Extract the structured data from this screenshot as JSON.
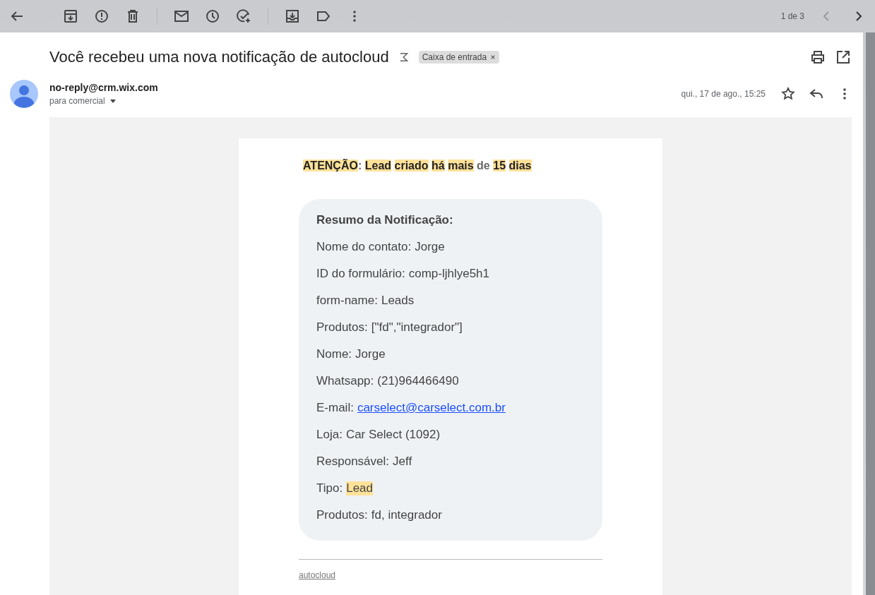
{
  "toolbar": {
    "pager": "1 de 3"
  },
  "email": {
    "subject": "Você recebeu uma nova notificação de autocloud",
    "label": "Caixa de entrada",
    "sender": "no-reply@crm.wix.com",
    "recipient": "para comercial",
    "date": "qui., 17 de ago., 15:25"
  },
  "alert": [
    {
      "text": "ATENÇÃO",
      "highlighted": true
    },
    {
      "text": ":",
      "highlighted": false,
      "attached": true
    },
    {
      "text": "Lead",
      "highlighted": true
    },
    {
      "text": "criado",
      "highlighted": true
    },
    {
      "text": "há",
      "highlighted": true
    },
    {
      "text": "mais",
      "highlighted": true
    },
    {
      "text": "de",
      "highlighted": false
    },
    {
      "text": "15",
      "highlighted": true
    },
    {
      "text": "dias",
      "highlighted": true
    }
  ],
  "summary": {
    "title": "Resumo da Notificação:",
    "fields": [
      {
        "label": "Nome do contato:",
        "value": "Jorge",
        "kind": "text"
      },
      {
        "label": "ID do formulário:",
        "value": "comp-ljhlye5h1",
        "kind": "text"
      },
      {
        "label": "form-name:",
        "value": "Leads",
        "kind": "text"
      },
      {
        "label": "Produtos:",
        "value": "[\"fd\",\"integrador\"]",
        "kind": "text"
      },
      {
        "label": "Nome:",
        "value": "Jorge",
        "kind": "text"
      },
      {
        "label": "Whatsapp:",
        "value": "(21)964466490",
        "kind": "text"
      },
      {
        "label": "E-mail:",
        "value": "carselect@carselect.com.br",
        "kind": "link"
      },
      {
        "label": "Loja:",
        "value": "Car Select (1092)",
        "kind": "text"
      },
      {
        "label": "Responsável:",
        "value": "Jeff",
        "kind": "text"
      },
      {
        "label": "Tipo:",
        "value": "Lead",
        "kind": "highlight"
      },
      {
        "label": "Produtos:",
        "value": "fd, integrador",
        "kind": "text"
      }
    ]
  },
  "footer": {
    "link": "autocloud"
  }
}
